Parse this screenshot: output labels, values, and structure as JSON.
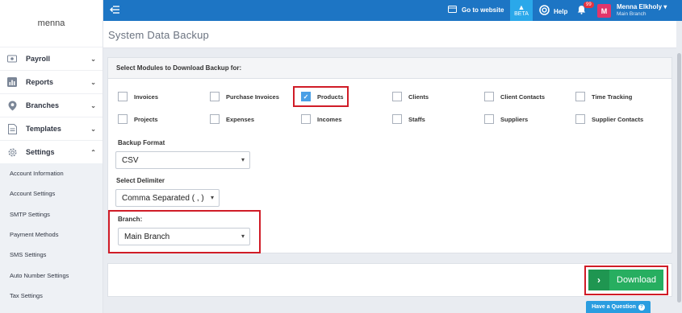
{
  "sidebar": {
    "brand": "menna",
    "items": [
      {
        "label": "Payroll",
        "icon": "payroll-icon",
        "chevron": "⌄"
      },
      {
        "label": "Reports",
        "icon": "reports-icon",
        "chevron": "⌄"
      },
      {
        "label": "Branches",
        "icon": "branches-icon",
        "chevron": "⌄"
      },
      {
        "label": "Templates",
        "icon": "templates-icon",
        "chevron": "⌄"
      },
      {
        "label": "Settings",
        "icon": "gear-icon",
        "chevron": "⌃"
      }
    ],
    "sub_items": [
      "Account Information",
      "Account Settings",
      "SMTP Settings",
      "Payment Methods",
      "SMS Settings",
      "Auto Number Settings",
      "Tax Settings"
    ]
  },
  "topbar": {
    "goto_label": "Go to website",
    "beta_label": "BETA",
    "help_label": "Help",
    "notif_count": "99",
    "avatar_letter": "M",
    "user_name": "Menna Elkholy",
    "user_branch": "Main Branch",
    "accent": "#1d75c4"
  },
  "page": {
    "title": "System Data Backup"
  },
  "modules": {
    "heading": "Select Modules to Download Backup for:",
    "items": [
      {
        "label": "Invoices",
        "checked": false
      },
      {
        "label": "Purchase Invoices",
        "checked": false
      },
      {
        "label": "Products",
        "checked": true
      },
      {
        "label": "Clients",
        "checked": false
      },
      {
        "label": "Client Contacts",
        "checked": false
      },
      {
        "label": "Time Tracking",
        "checked": false
      },
      {
        "label": "Projects",
        "checked": false
      },
      {
        "label": "Expenses",
        "checked": false
      },
      {
        "label": "Incomes",
        "checked": false
      },
      {
        "label": "Staffs",
        "checked": false
      },
      {
        "label": "Suppliers",
        "checked": false
      },
      {
        "label": "Supplier Contacts",
        "checked": false
      }
    ]
  },
  "form": {
    "format_label": "Backup Format",
    "format_value": "CSV",
    "delimiter_label": "Select Delimiter",
    "delimiter_value": "Comma Separated ( , )",
    "branch_label": "Branch:",
    "branch_value": "Main Branch"
  },
  "actions": {
    "download_label": "Download",
    "question_label": "Have a Question",
    "download_color": "#27ae60",
    "highlight_color": "#d01c27"
  }
}
